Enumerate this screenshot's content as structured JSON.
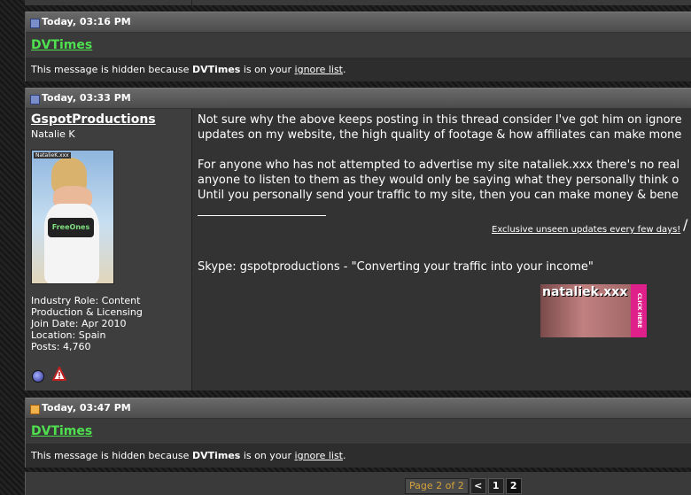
{
  "posts": {
    "p1": {
      "date": "Today, 03:16 PM",
      "username": "DVTimes",
      "msg_pre": "This message is hidden because ",
      "msg_user": "DVTimes",
      "msg_mid": " is on your ",
      "msg_link": "ignore list",
      "msg_end": "."
    },
    "p2": {
      "date": "Today, 03:33 PM",
      "username": "GspotProductions",
      "usertitle": "Natalie K",
      "avatar_text": "NatalieK.xxx",
      "avatar_logo": "FreeOnes",
      "info": {
        "role1": "Industry Role: Content",
        "role2": "Production & Licensing",
        "join": "Join Date: Apr 2010",
        "location": "Location: Spain",
        "posts": "Posts: 4,760"
      },
      "content": {
        "line1": "Not sure why the above keeps posting in this thread consider I've got him on ignore",
        "line2": "updates on my website, the high quality of footage & how affiliates can make mone",
        "line3": "For anyone who has not attempted to advertise my site nataliek.xxx there's no real",
        "line4": "anyone to listen to them as they would only be saying what they personally think o",
        "line5": "Until you personally send your traffic to my site, then you can make money & bene",
        "sig_link": "Exclusive unseen updates every few days!",
        "sig_slash": "/",
        "skype": "Skype: gspotproductions - \"Converting your traffic into your income\"",
        "banner_text": "nataliek.xxx",
        "banner_click": "CLICK HERE"
      }
    },
    "p3": {
      "date": "Today, 03:47 PM",
      "username": "DVTimes",
      "msg_pre": "This message is hidden because ",
      "msg_user": "DVTimes",
      "msg_mid": " is on your ",
      "msg_link": "ignore list",
      "msg_end": "."
    }
  },
  "pagination": {
    "label": "Page 2 of 2",
    "prev": "<",
    "p1": "1",
    "p2": "2"
  },
  "colors": {
    "username_green": "#4fe04f",
    "pager_label": "#d4a23a"
  },
  "icons": {
    "post_icon": "post-icon",
    "new_post_icon": "new-post-icon",
    "online_status": "online-status-icon",
    "report": "report-post-icon"
  }
}
